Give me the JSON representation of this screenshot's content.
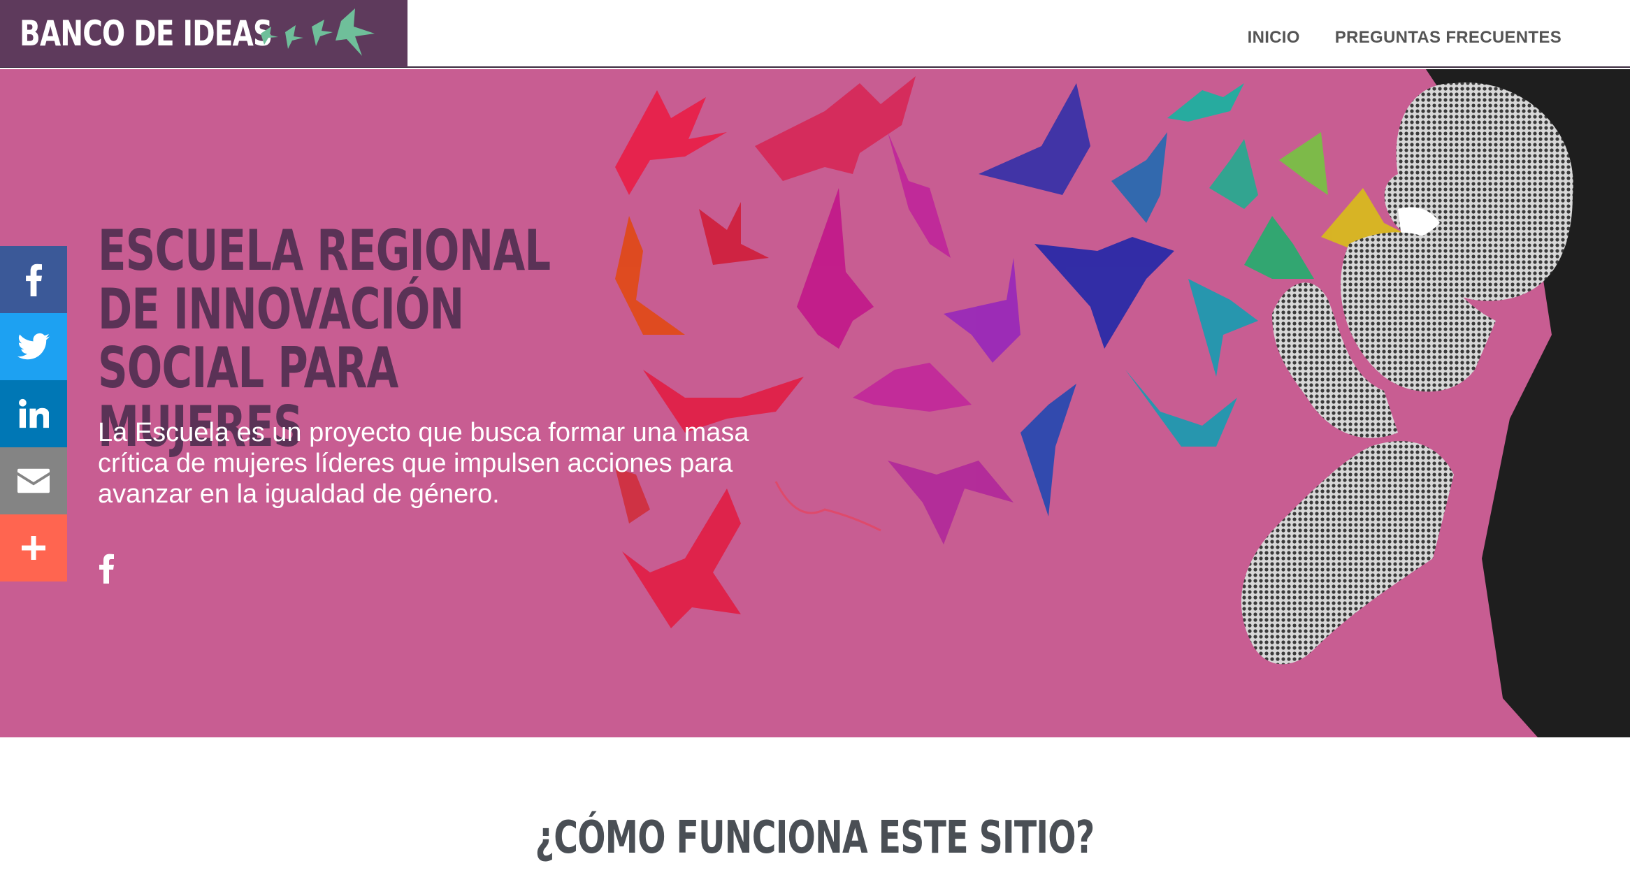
{
  "header": {
    "logo_text": "BANCO DE IDEAS",
    "nav": [
      {
        "label": "INICIO"
      },
      {
        "label": "PREGUNTAS FRECUENTES"
      }
    ]
  },
  "hero": {
    "title": "ESCUELA REGIONAL DE INNOVACIÓN SOCIAL PARA MUJERES",
    "description": "La Escuela es un proyecto que busca formar una masa crítica de mujeres líderes que impulsen acciones para avanzar en la igualdad de género.",
    "social_icon": "facebook-icon"
  },
  "share_bar": {
    "items": [
      {
        "icon": "facebook-icon",
        "color": "#3b5998"
      },
      {
        "icon": "twitter-icon",
        "color": "#1da1f2"
      },
      {
        "icon": "linkedin-icon",
        "color": "#0077b5"
      },
      {
        "icon": "email-icon",
        "color": "#848484"
      },
      {
        "icon": "plus-icon",
        "color": "#ff6550"
      }
    ]
  },
  "section": {
    "title": "¿CÓMO FUNCIONA ESTE SITIO?"
  },
  "colors": {
    "brand_purple": "#5e3a5c",
    "hero_pink": "#c85d92",
    "title_purple": "#5a3256",
    "section_gray": "#4a4f55"
  }
}
